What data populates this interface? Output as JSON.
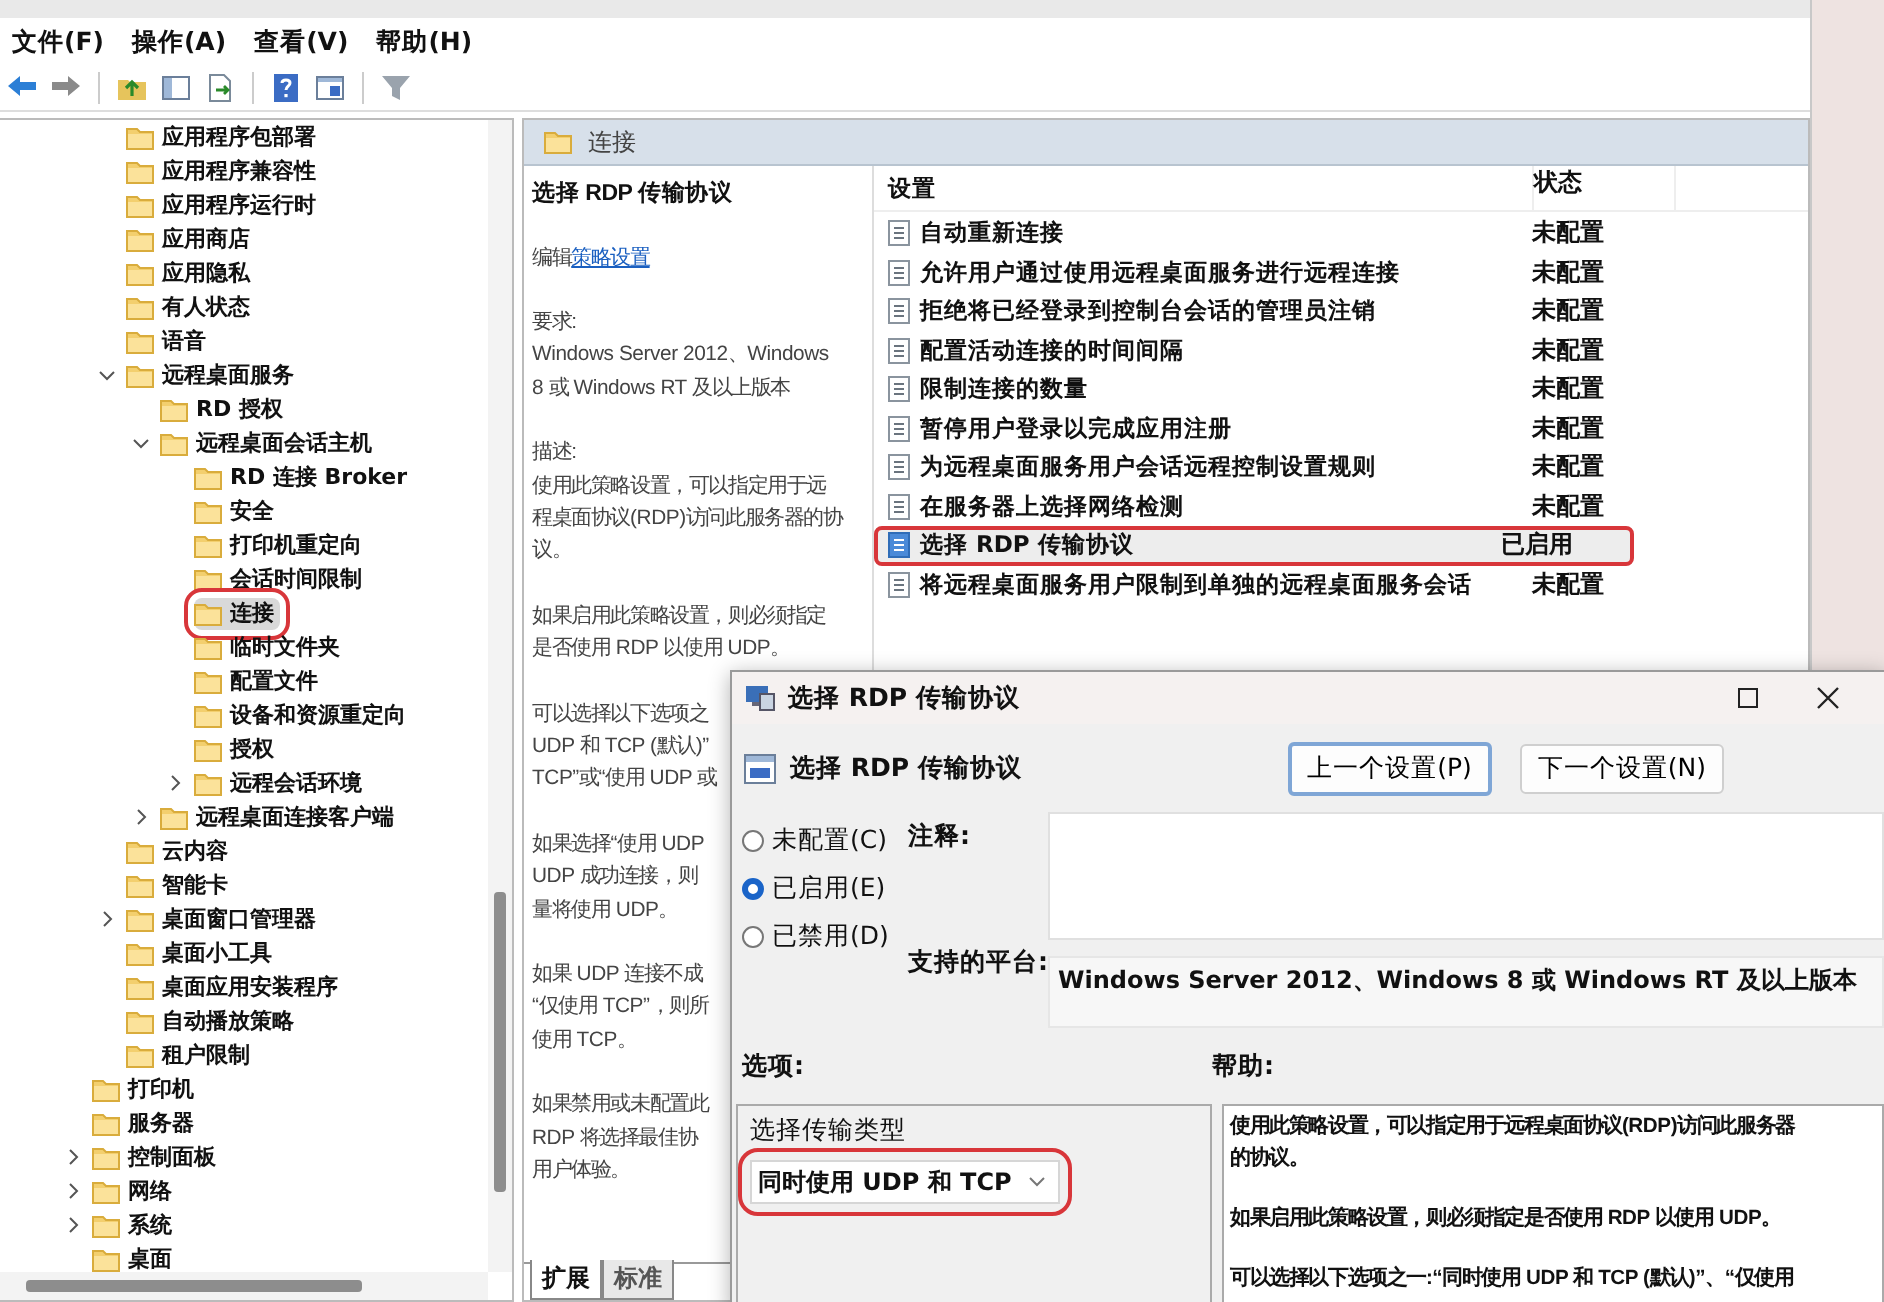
{
  "menu": [
    "文件(F)",
    "操作(A)",
    "查看(V)",
    "帮助(H)"
  ],
  "tree": {
    "continued_children": [
      {
        "label": "应用程序包部署",
        "selected": false
      },
      {
        "label": "应用程序兼容性",
        "selected": false
      },
      {
        "label": "应用程序运行时",
        "selected": false
      },
      {
        "label": "应用商店",
        "selected": false
      },
      {
        "label": "应用隐私",
        "selected": false
      },
      {
        "label": "有人状态",
        "selected": false
      },
      {
        "label": "语音",
        "selected": false
      },
      {
        "label": "远程桌面服务",
        "selected": false,
        "expanded": true,
        "children": [
          {
            "label": "RD 授权",
            "selected": false
          },
          {
            "label": "远程桌面会话主机",
            "selected": false,
            "expanded": true,
            "children": [
              {
                "label": "RD 连接 Broker",
                "selected": false
              },
              {
                "label": "安全",
                "selected": false
              },
              {
                "label": "打印机重定向",
                "selected": false
              },
              {
                "label": "会话时间限制",
                "selected": false
              },
              {
                "label": "连接",
                "selected": true,
                "annotated": true
              },
              {
                "label": "临时文件夹",
                "selected": false
              },
              {
                "label": "配置文件",
                "selected": false
              },
              {
                "label": "设备和资源重定向",
                "selected": false
              },
              {
                "label": "授权",
                "selected": false
              },
              {
                "label": "远程会话环境",
                "selected": false,
                "expanded": false
              }
            ]
          },
          {
            "label": "远程桌面连接客户端",
            "selected": false,
            "expanded": false
          }
        ]
      },
      {
        "label": "云内容",
        "selected": false
      },
      {
        "label": "智能卡",
        "selected": false
      },
      {
        "label": "桌面窗口管理器",
        "selected": false,
        "expanded": false
      },
      {
        "label": "桌面小工具",
        "selected": false
      },
      {
        "label": "桌面应用安装程序",
        "selected": false
      },
      {
        "label": "自动播放策略",
        "selected": false
      },
      {
        "label": "租户限制",
        "selected": false
      }
    ],
    "items": [
      {
        "label": "打印机",
        "selected": false
      },
      {
        "label": "服务器",
        "selected": false
      },
      {
        "label": "控制面板",
        "selected": false,
        "expanded": false
      },
      {
        "label": "网络",
        "selected": false,
        "expanded": false
      },
      {
        "label": "系统",
        "selected": false,
        "expanded": false
      },
      {
        "label": "桌面",
        "selected": false
      }
    ]
  },
  "details": {
    "header": "连接",
    "title": "选择 RDP 传输协议",
    "edit_prefix": "编辑",
    "edit_link": "策略设置",
    "paragraphs": [
      [
        "要求:",
        "Windows Server 2012、Windows",
        "8 或 Windows RT 及以上版本"
      ],
      [
        "描述:",
        "使用此策略设置，可以指定用于远",
        "程桌面协议(RDP)访问此服务器的协",
        "议。"
      ],
      [
        "如果启用此策略设置，则必须指定",
        "是否使用 RDP 以使用 UDP。"
      ],
      [
        "可以选择以下选项之",
        "UDP 和 TCP (默认)”",
        "TCP”或“使用 UDP 或"
      ],
      [
        "如果选择“使用 UDP",
        "UDP 成功连接，则",
        "量将使用 UDP。"
      ],
      [
        "如果 UDP 连接不成",
        "“仅使用 TCP”，则所",
        "使用 TCP。"
      ],
      [
        "如果禁用或未配置此",
        "RDP 将选择最佳协",
        "用户体验。"
      ]
    ],
    "tabs": [
      {
        "label": "扩展",
        "selected": true
      },
      {
        "label": "标准",
        "selected": false
      }
    ]
  },
  "settings_list": {
    "columns": [
      "设置",
      "状态"
    ],
    "rows": [
      {
        "name": "自动重新连接",
        "status": "未配置",
        "selected": false
      },
      {
        "name": "允许用户通过使用远程桌面服务进行远程连接",
        "status": "未配置",
        "selected": false
      },
      {
        "name": "拒绝将已经登录到控制台会话的管理员注销",
        "status": "未配置",
        "selected": false
      },
      {
        "name": "配置活动连接的时间间隔",
        "status": "未配置",
        "selected": false
      },
      {
        "name": "限制连接的数量",
        "status": "未配置",
        "selected": false
      },
      {
        "name": "暂停用户登录以完成应用注册",
        "status": "未配置",
        "selected": false
      },
      {
        "name": "为远程桌面服务用户会话远程控制设置规则",
        "status": "未配置",
        "selected": false
      },
      {
        "name": "在服务器上选择网络检测",
        "status": "未配置",
        "selected": false
      },
      {
        "name": "选择 RDP 传输协议",
        "status": "已启用",
        "selected": true,
        "annotated": true
      },
      {
        "name": "将远程桌面服务用户限制到单独的远程桌面服务会话",
        "status": "未配置",
        "selected": false
      }
    ]
  },
  "dialog": {
    "title": "选择 RDP 传输协议",
    "heading": "选择 RDP 传输协议",
    "buttons": [
      {
        "label": "上一个设置(P)",
        "focused": true
      },
      {
        "label": "下一个设置(N)",
        "focused": false
      }
    ],
    "states": [
      {
        "label": "未配置(C)",
        "selected": false
      },
      {
        "label": "已启用(E)",
        "selected": true
      },
      {
        "label": "已禁用(D)",
        "selected": false
      }
    ],
    "comment_label": "注释:",
    "platform_label": "支持的平台:",
    "platform": "Windows Server 2012、Windows 8 或 Windows RT 及以上版本",
    "options_label": "选项:",
    "help_label": "帮助:",
    "options": [
      {
        "label": "选择传输类型",
        "value": "同时使用 UDP 和 TCP",
        "annotated": true
      }
    ],
    "help_paragraphs": [
      [
        "使用此策略设置，可以指定用于远程桌面协议(RDP)访问此服务器",
        "的协议。"
      ],
      [
        "如果启用此策略设置，则必须指定是否使用 RDP 以使用 UDP。"
      ],
      [
        "可以选择以下选项之一:“同时使用 UDP 和 TCP (默认)”、“仅使用"
      ]
    ]
  }
}
